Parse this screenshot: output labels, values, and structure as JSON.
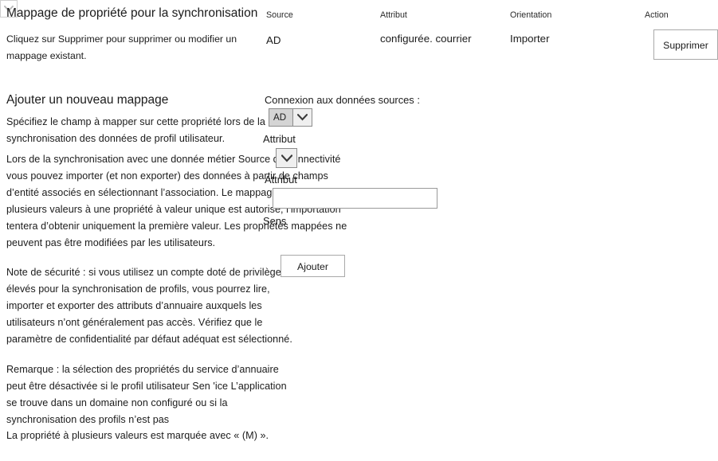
{
  "page": {
    "title": "Mappage de propriété pour la synchronisation",
    "intro": "Cliquez sur Supprimer pour supprimer ou modifier un mappage existant."
  },
  "mapping_table": {
    "columns": {
      "source": "Source",
      "attribut": "Attribut",
      "orientation": "Orientation",
      "action": "Action"
    },
    "rows": [
      {
        "source": "AD",
        "attribut": "configurée. courrier",
        "orientation": "Importer",
        "action_label": "Supprimer"
      }
    ]
  },
  "add_mapping": {
    "heading": "Ajouter un nouveau mappage",
    "paragraphs": {
      "p1": "Spécifiez le champ à mapper sur cette propriété lors de la synchronisation des données de profil utilisateur.",
      "p2": "Lors de la synchronisation avec une donnée métier Source de connectivité vous pouvez importer (et non exporter) des données à partir de champs d’entité associés en sélectionnant l’association. Le mappage d’un champ à plusieurs valeurs à une propriété à valeur unique est autorisé, l’importation tentera d’obtenir uniquement la première valeur. Les propriétés mappées ne peuvent pas être modifiées par les utilisateurs.",
      "p3": "Note de sécurité : si vous utilisez un compte doté de privilèges élevés pour la synchronisation de profils, vous pourrez lire, importer et exporter des attributs d’annuaire auxquels les utilisateurs n’ont généralement pas accès. Vérifiez que le paramètre de confidentialité par défaut adéquat est sélectionné.",
      "p4": "Remarque : la sélection des propriétés du service d’annuaire peut être désactivée si le profil utilisateur Sen 'ice L’application se trouve dans un domaine non configuré ou si la synchronisation des profils n’est pas",
      "p5": "La propriété à plusieurs valeurs est marquée avec « (M) »."
    },
    "form": {
      "connection_label": "Connexion aux données sources :",
      "connection_value": "AD",
      "attribute_select_label": "Attribut",
      "attribute_select_value": "",
      "attribute_text_label": "Attribut",
      "attribute_text_value": "",
      "attribute_text_placeholder": "",
      "direction_label": "Sens",
      "direction_value": "",
      "submit_label": "Ajouter"
    }
  },
  "colors": {
    "background": "#ffffff",
    "text": "#1b1b1b",
    "border": "#a9a9a9",
    "combo_fill": "#d4d4d4",
    "combo_arrow_fill": "#efefef"
  }
}
